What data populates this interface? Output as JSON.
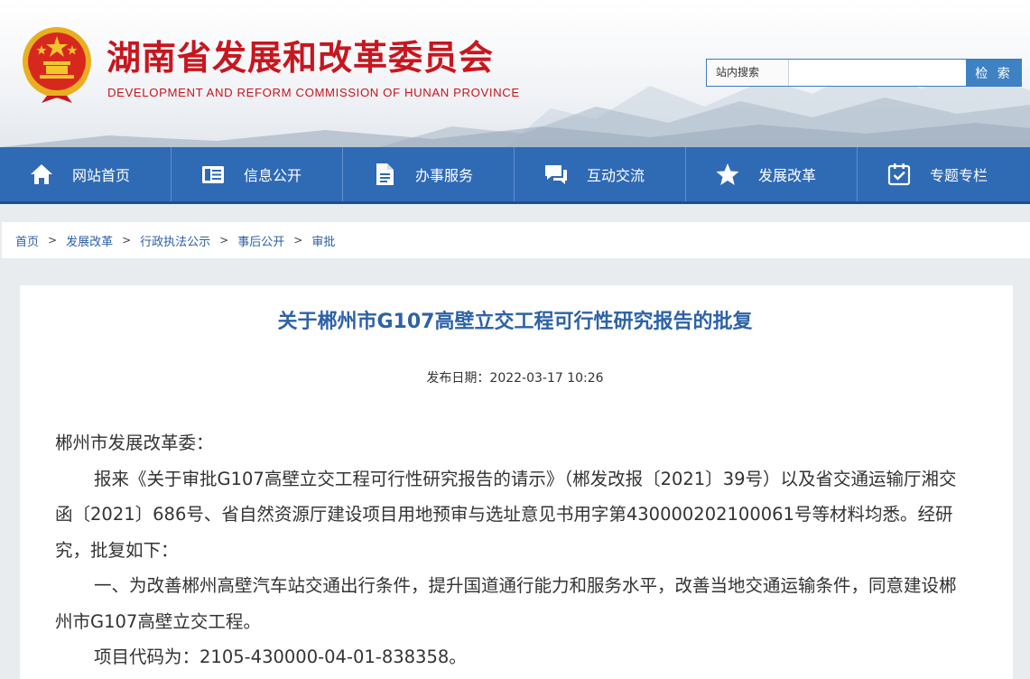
{
  "header": {
    "title": "湖南省发展和改革委员会",
    "subtitle": "DEVELOPMENT AND REFORM COMMISSION OF HUNAN PROVINCE",
    "emblem_icon": "national-emblem-icon",
    "search": {
      "label": "站内搜索",
      "placeholder": "",
      "button": "检 索"
    },
    "brand_color": "#c8161e"
  },
  "nav": {
    "color": "#2f6ab5",
    "items": [
      {
        "label": "网站首页",
        "icon": "home-icon"
      },
      {
        "label": "信息公开",
        "icon": "document-list-icon"
      },
      {
        "label": "办事服务",
        "icon": "file-icon"
      },
      {
        "label": "互动交流",
        "icon": "chat-icon"
      },
      {
        "label": "发展改革",
        "icon": "star-icon"
      },
      {
        "label": "专题专栏",
        "icon": "calendar-check-icon"
      }
    ]
  },
  "breadcrumb": {
    "items": [
      "首页",
      "发展改革",
      "行政执法公示",
      "事后公开",
      "审批"
    ],
    "separator": ">"
  },
  "article": {
    "title": "关于郴州市G107高壁立交工程可行性研究报告的批复",
    "date": "发布日期：2022-03-17 10:26",
    "salutation": "郴州市发展改革委：",
    "paragraphs": [
      "报来《关于审批G107高壁立交工程可行性研究报告的请示》（郴发改报〔2021〕39号）以及省交通运输厅湘交函〔2021〕686号、省自然资源厅建设项目用地预审与选址意见书用字第430000202100061号等材料均悉。经研究，批复如下：",
      "一、为改善郴州高壁汽车站交通出行条件，提升国道通行能力和服务水平，改善当地交通运输条件，同意建设郴州市G107高壁立交工程。",
      "项目代码为：2105-430000-04-01-838358。"
    ]
  }
}
